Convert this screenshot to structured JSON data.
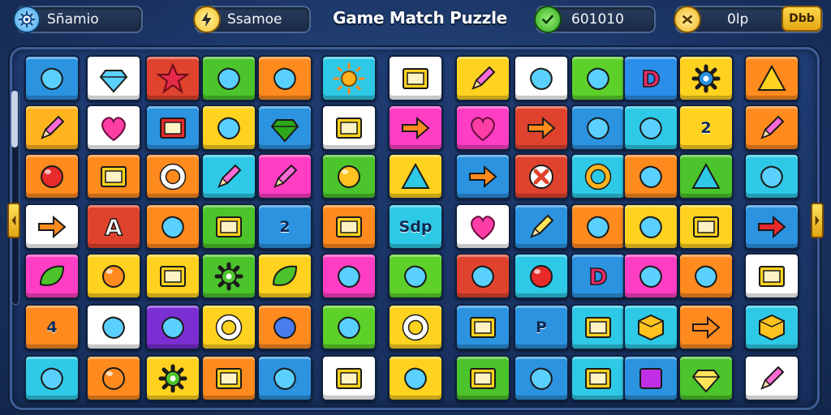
{
  "header": {
    "title": "Game Match Puzzle",
    "player": {
      "label": "Sñamio",
      "icon": "gear-badge-icon"
    },
    "mode": {
      "label": "Ssamoe",
      "icon": "lightning-icon"
    },
    "score": {
      "value": "601010",
      "icon": "green-check-coin-icon"
    },
    "coins": {
      "value": "0lp",
      "icon": "gold-coin-icon",
      "button_label": "Dbb"
    }
  },
  "colors": {
    "background": "#1b3566",
    "board": "#1f3d75",
    "accent_gold": "#f5c22b"
  },
  "board": {
    "rows": [
      [
        {
          "bg": "#2b93e0",
          "icon": "green-monster-icon"
        },
        {
          "bg": "#ffffff",
          "icon": "diamond-cursor-icon"
        },
        {
          "bg": "#e0432d",
          "icon": "star-icon"
        },
        {
          "bg": "#4cc42b",
          "icon": "globe-icon"
        },
        {
          "bg": "#ff8a1e",
          "icon": "smile-balloon-icon"
        },
        {
          "bg": "#2ec9e6",
          "icon": "sun-icon"
        },
        {
          "bg": "#ffffff",
          "icon": "yellow-frame-icon"
        },
        {
          "bg": "#ffd21f",
          "icon": "pencil-icon"
        },
        {
          "bg": "#ffffff",
          "icon": "bear-face-icon"
        },
        {
          "bg": "#5dd12a",
          "icon": "red-pin-icon"
        },
        {
          "bg": "#2b8ee8",
          "icon": "letter-d-icon"
        },
        {
          "bg": "#ffd21f",
          "icon": "flower-badge-icon"
        },
        {
          "bg": "#ff8a1e",
          "icon": "triangle-icon"
        }
      ],
      [
        {
          "bg": "#ffb520",
          "icon": "dart-icon"
        },
        {
          "bg": "#ffffff",
          "icon": "heart-icon"
        },
        {
          "bg": "#2b93e0",
          "icon": "red-envelope-icon"
        },
        {
          "bg": "#ffd21f",
          "icon": "swirl-icon"
        },
        {
          "bg": "#2b93e0",
          "icon": "green-gem-icon"
        },
        {
          "bg": "#ffffff",
          "icon": "book-icon"
        },
        {
          "bg": "#ff3ec4",
          "icon": "paper-plane-icon"
        },
        {
          "bg": "#ff3ec4",
          "icon": "shield-heart-icon"
        },
        {
          "bg": "#e0432d",
          "icon": "arrow-up-icon"
        },
        {
          "bg": "#2b93e0",
          "icon": "gold-coin-face-icon"
        },
        {
          "bg": "#2ec9e6",
          "icon": "magnifier-icon"
        },
        {
          "bg": "#ffd21f",
          "icon": "number-tag-icon",
          "text": "2"
        },
        {
          "bg": "#ff8a1e",
          "icon": "crayon-icon"
        }
      ],
      [
        {
          "bg": "#ff8a1e",
          "icon": "red-ball-icon"
        },
        {
          "bg": "#ff8a1e",
          "icon": "picture-frame-icon"
        },
        {
          "bg": "#ff8a1e",
          "icon": "ring-icon"
        },
        {
          "bg": "#2ec9e6",
          "icon": "wand-icon"
        },
        {
          "bg": "#ff3ec4",
          "icon": "paintbrush-icon"
        },
        {
          "bg": "#4cc42b",
          "icon": "yellow-orb-icon"
        },
        {
          "bg": "#ffd21f",
          "icon": "play-triangle-icon"
        },
        {
          "bg": "#2b93e0",
          "icon": "right-arrow-icon"
        },
        {
          "bg": "#e0432d",
          "icon": "x-mark-icon"
        },
        {
          "bg": "#2ec9e6",
          "icon": "donut-icon"
        },
        {
          "bg": "#ff8a1e",
          "icon": "cross-icon"
        },
        {
          "bg": "#4cc42b",
          "icon": "play-button-icon"
        },
        {
          "bg": "#2ec9e6",
          "icon": "eye-icon"
        }
      ],
      [
        {
          "bg": "#ffffff",
          "icon": "kite-icon"
        },
        {
          "bg": "#e0432d",
          "icon": "letter-a-icon"
        },
        {
          "bg": "#ff8a1e",
          "icon": "jar-icon"
        },
        {
          "bg": "#4cc42b",
          "icon": "frame-icon"
        },
        {
          "bg": "#2b93e0",
          "icon": "star-badge-icon",
          "text": "2"
        },
        {
          "bg": "#ff8a1e",
          "icon": "clipboard-icon"
        },
        {
          "bg": "#2ec9e6",
          "icon": "sdp-text-icon",
          "text": "Sdp"
        },
        {
          "bg": "#ffffff",
          "icon": "pink-heart-icon"
        },
        {
          "bg": "#2b93e0",
          "icon": "yellow-pencil-icon"
        },
        {
          "bg": "#ff8a1e",
          "icon": "stopwatch-icon"
        },
        {
          "bg": "#ffd21f",
          "icon": "figures-icon"
        },
        {
          "bg": "#ffd21f",
          "icon": "envelope-icon"
        },
        {
          "bg": "#2b93e0",
          "icon": "red-plane-icon"
        }
      ],
      [
        {
          "bg": "#ff3ec4",
          "icon": "green-leaf-icon"
        },
        {
          "bg": "#ffd21f",
          "icon": "basketball-icon"
        },
        {
          "bg": "#ffd21f",
          "icon": "chest-icon"
        },
        {
          "bg": "#4cc42b",
          "icon": "gear-icon"
        },
        {
          "bg": "#ffd21f",
          "icon": "green-pepper-icon"
        },
        {
          "bg": "#ff3ec4",
          "icon": "camera-icon"
        },
        {
          "bg": "#5dd12a",
          "icon": "taco-icon"
        },
        {
          "bg": "#e0432d",
          "icon": "recycle-icon"
        },
        {
          "bg": "#2ec9e6",
          "icon": "red-sphere-icon"
        },
        {
          "bg": "#2b93e0",
          "icon": "d-badge-icon"
        },
        {
          "bg": "#ff3ec4",
          "icon": "puzzle-m-icon"
        },
        {
          "bg": "#ff8a1e",
          "icon": "flag-icon"
        },
        {
          "bg": "#ffffff",
          "icon": "cube-panels-icon"
        }
      ],
      [
        {
          "bg": "#ff8a1e",
          "icon": "card-4-icon",
          "text": "4"
        },
        {
          "bg": "#ffffff",
          "icon": "puzzle-piece-icon"
        },
        {
          "bg": "#7b2ed1",
          "icon": "yellow-bolt-icon"
        },
        {
          "bg": "#ffd21f",
          "icon": "horseshoe-icon"
        },
        {
          "bg": "#ff8a1e",
          "icon": "blue-heart-icon"
        },
        {
          "bg": "#5dd12a",
          "icon": "bottle-icon"
        },
        {
          "bg": "#ffd21f",
          "icon": "magnet-ring-icon"
        },
        {
          "bg": "#2b93e0",
          "icon": "document-icon"
        },
        {
          "bg": "#2b93e0",
          "icon": "letter-p-icon",
          "text": "P"
        },
        {
          "bg": "#2ec9e6",
          "icon": "square-frame-icon"
        },
        {
          "bg": "#2ec9e6",
          "icon": "box-icon"
        },
        {
          "bg": "#ff8a1e",
          "icon": "bird-icon"
        },
        {
          "bg": "#2ec9e6",
          "icon": "cake-icon"
        }
      ],
      [
        {
          "bg": "#2ec9e6",
          "icon": "magnifying-glass-icon"
        },
        {
          "bg": "#ff8a1e",
          "icon": "striped-ball-icon"
        },
        {
          "bg": "#ffd21f",
          "icon": "cog-icon"
        },
        {
          "bg": "#ff8a1e",
          "icon": "ticket-icon"
        },
        {
          "bg": "#2b93e0",
          "icon": "saucer-icon"
        },
        {
          "bg": "#ffffff",
          "icon": "tag-icon"
        },
        {
          "bg": "#ffd21f",
          "icon": "red-fish-icon"
        },
        {
          "bg": "#4cc42b",
          "icon": "note-card-icon"
        },
        {
          "bg": "#2b93e0",
          "icon": "torch-icon"
        },
        {
          "bg": "#2ec9e6",
          "icon": "d-card-icon"
        },
        {
          "bg": "#2b93e0",
          "icon": "purple-square-icon"
        },
        {
          "bg": "#4cc42b",
          "icon": "yellow-gem-icon"
        },
        {
          "bg": "#ffffff",
          "icon": "eraser-icon"
        }
      ]
    ]
  }
}
